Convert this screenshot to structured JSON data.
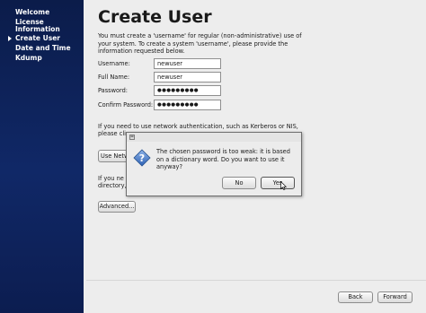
{
  "sidebar": {
    "items": [
      {
        "label": "Welcome"
      },
      {
        "label": "License"
      },
      {
        "label": "Information"
      },
      {
        "label": "Create User"
      },
      {
        "label": "Date and Time"
      },
      {
        "label": "Kdump"
      }
    ],
    "active": "Create User"
  },
  "main": {
    "title": "Create User",
    "intro": "You must create a 'username' for regular (non-administrative) use of your system.  To create a system 'username', please provide the information requested below.",
    "form": {
      "username_label": "Username:",
      "username_value": "newuser",
      "fullname_label": "Full Name:",
      "fullname_value": "newuser",
      "password_label": "Password:",
      "password_value": "●●●●●●●●●",
      "confirm_label": "Confirm Password:",
      "confirm_value": "●●●●●●●●●"
    },
    "network_para_line1": "If you need to use network authentication, such as Kerberos or NIS,",
    "network_para_line2": "please clic",
    "network_button_label": "Use Netw",
    "directory_para_line1": "If you ne",
    "directory_para_line2": "directory,",
    "advanced_button_label": "Advanced..."
  },
  "footer": {
    "back_label": "Back",
    "forward_label": "Forward"
  },
  "dialog": {
    "message": "The chosen password is too weak: it is based on a dictionary word. Do you want to use it anyway?",
    "no_label": "No",
    "yes_label": "Yes",
    "icon": "question-icon"
  },
  "colors": {
    "sidebar_bg": "#102867",
    "page_bg": "#ededed"
  }
}
